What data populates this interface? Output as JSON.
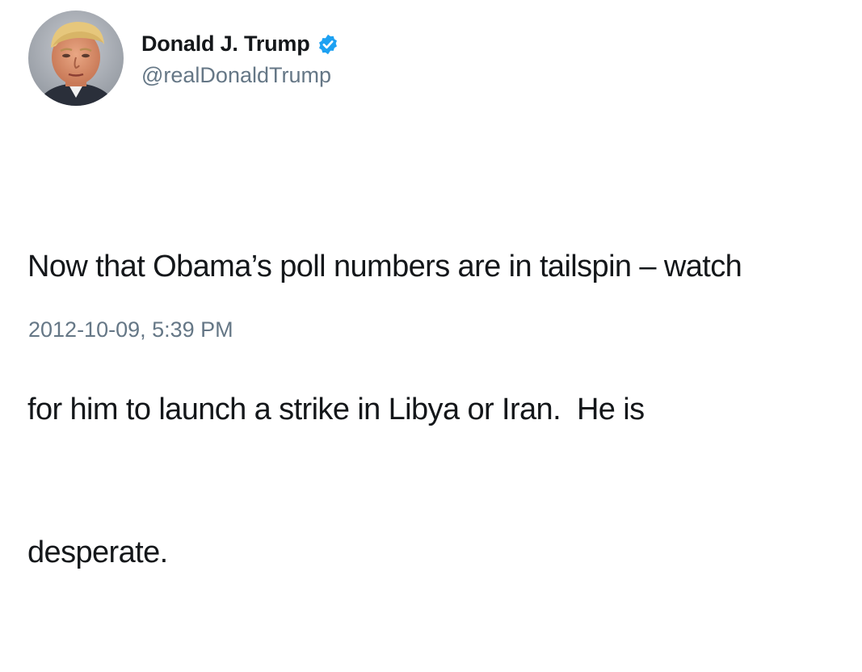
{
  "tweet": {
    "author": {
      "display_name": "Donald J. Trump",
      "handle": "@realDonaldTrump",
      "verified": true,
      "avatar_icon": "profile-photo"
    },
    "text_lines": [
      "Now that Obama’s poll numbers are in tailspin – watch",
      "for him to launch a strike in Libya or Iran.  He is",
      "desperate."
    ],
    "timestamp": "2012-10-09, 5:39 PM"
  },
  "colors": {
    "verified_badge": "#1da1f2",
    "secondary_text": "#657786",
    "primary_text": "#14171a"
  }
}
